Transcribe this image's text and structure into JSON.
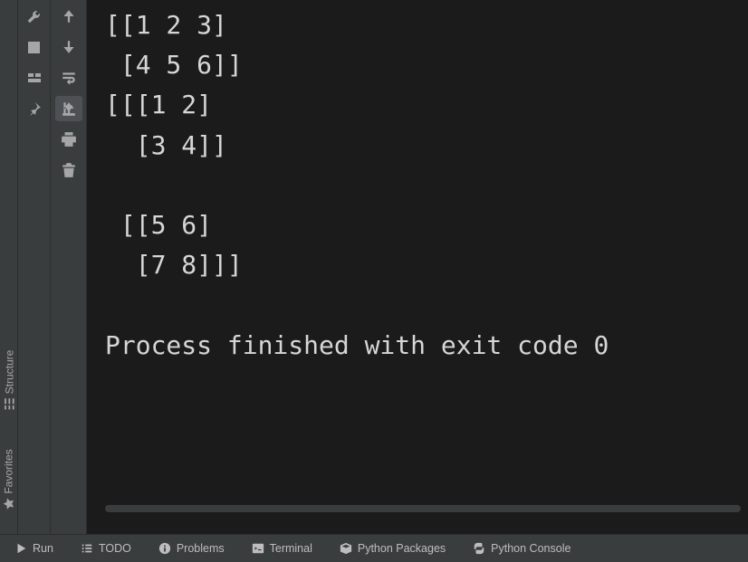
{
  "left_strip": {
    "structure": {
      "label": "Structure"
    },
    "favorites": {
      "label": "Favorites"
    }
  },
  "gutter1": {
    "restart": "restart",
    "step_down": "step-down",
    "stop": "stop",
    "layout": "layout",
    "pin": "pin"
  },
  "gutter2": {
    "up": "previous",
    "down": "next",
    "wrap": "soft-wrap",
    "scroll": "scroll-to-end",
    "print": "print",
    "trash": "clear-all"
  },
  "console": {
    "lines": [
      "[[1 2 3]",
      " [4 5 6]]",
      "[[[1 2]",
      "  [3 4]]",
      "",
      " [[5 6]",
      "  [7 8]]]",
      "",
      "Process finished with exit code 0"
    ]
  },
  "bottom_bar": {
    "run": "Run",
    "todo": "TODO",
    "problems": "Problems",
    "terminal": "Terminal",
    "pkgs": "Python Packages",
    "pyconsole": "Python Console"
  }
}
